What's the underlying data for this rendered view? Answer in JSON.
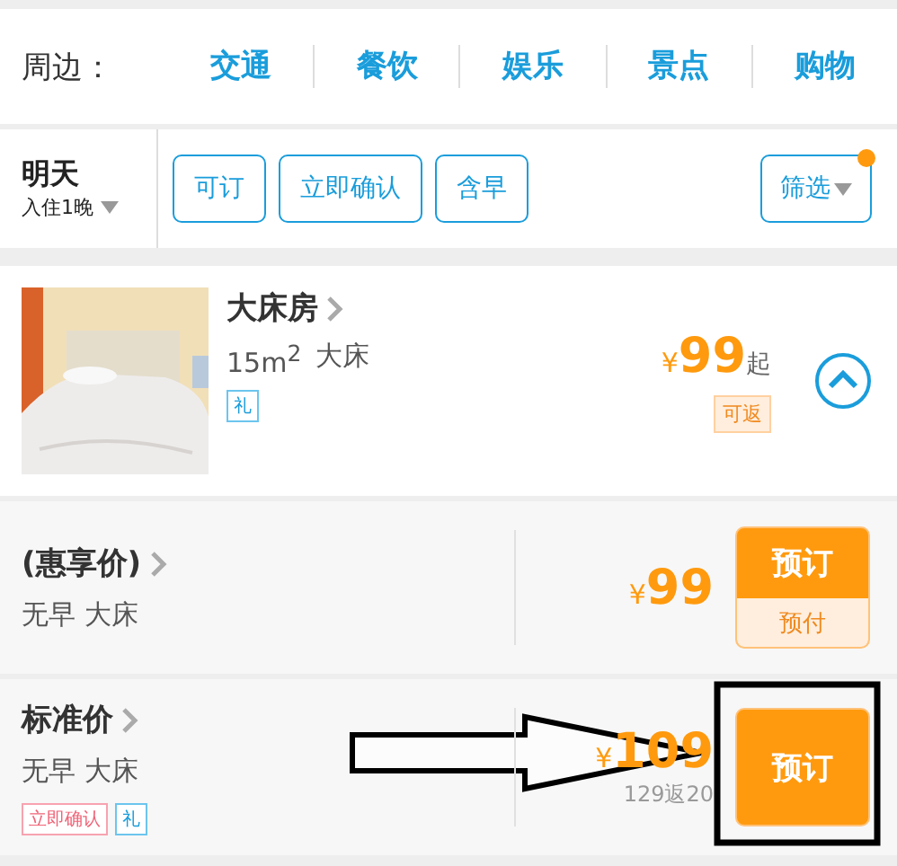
{
  "nearby": {
    "label": "周边：",
    "links": [
      "交通",
      "餐饮",
      "娱乐",
      "景点",
      "购物"
    ]
  },
  "filter_bar": {
    "date": {
      "day": "明天",
      "nights": "入住1晚"
    },
    "chips": [
      {
        "label": "可订",
        "selected": false
      },
      {
        "label": "立即确认",
        "selected": false
      },
      {
        "label": "含早",
        "selected": false
      }
    ],
    "filter_button": {
      "label": "筛选",
      "has_dot": true
    }
  },
  "room": {
    "name": "大床房",
    "area": "15m$^{2}$",
    "bed": "大床",
    "tags": [
      {
        "label": "礼",
        "kind": "gift"
      }
    ],
    "currency": "¥",
    "price": "99",
    "price_suffix": "起",
    "cashback": "可返",
    "expanded": true
  },
  "rates": [
    {
      "name": "(惠享价)",
      "meta": "无早 大床",
      "currency": "¥",
      "price": "99",
      "button": {
        "label": "预订",
        "sub": "预付"
      },
      "highlighted": false
    },
    {
      "name": "标准价",
      "meta": "无早 大床",
      "tags": [
        {
          "label": "立即确认",
          "kind": "instant"
        },
        {
          "label": "礼",
          "kind": "gift"
        }
      ],
      "currency": "¥",
      "price": "109",
      "note": "129返20",
      "button": {
        "label": "预订"
      },
      "highlighted": true
    }
  ]
}
